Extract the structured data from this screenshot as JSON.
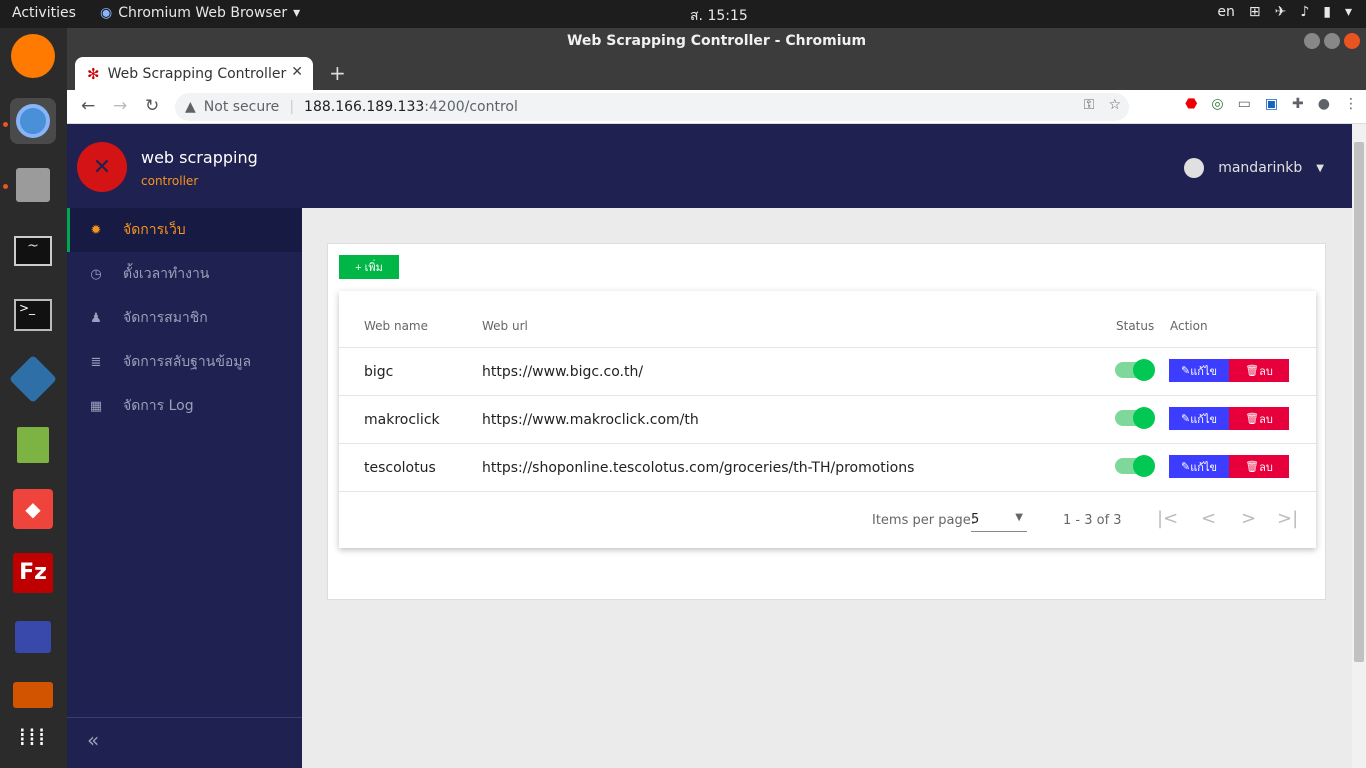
{
  "os": {
    "activities": "Activities",
    "app_menu": "Chromium Web Browser",
    "clock": "ส. 15:15",
    "lang": "en"
  },
  "window": {
    "title": "Web Scrapping Controller - Chromium"
  },
  "tab": {
    "title": "Web Scrapping Controller",
    "new_tab": "+"
  },
  "address": {
    "security": "Not secure",
    "host": "188.166.189.133",
    "path": ":4200/control"
  },
  "app": {
    "brand_title": "web scrapping",
    "brand_sub": "controller",
    "username": "mandarinkb",
    "sidebar": [
      {
        "label": "จัดการเว็บ",
        "icon": "gear-icon",
        "active": true
      },
      {
        "label": "ตั้งเวลาทำงาน",
        "icon": "clock-icon",
        "active": false
      },
      {
        "label": "จัดการสมาชิก",
        "icon": "users-icon",
        "active": false
      },
      {
        "label": "จัดการสลับฐานข้อมูล",
        "icon": "database-icon",
        "active": false
      },
      {
        "label": "จัดการ Log",
        "icon": "calendar-icon",
        "active": false
      }
    ],
    "add_button": "+ เพิ่ม",
    "table": {
      "headers": {
        "name": "Web name",
        "url": "Web url",
        "status": "Status",
        "action": "Action"
      },
      "rows": [
        {
          "name": "bigc",
          "url": "https://www.bigc.co.th/",
          "status": true
        },
        {
          "name": "makroclick",
          "url": "https://www.makroclick.com/th",
          "status": true
        },
        {
          "name": "tescolotus",
          "url": "https://shoponline.tescolotus.com/groceries/th-TH/promotions",
          "status": true
        }
      ],
      "edit_label": "แก้ไข",
      "delete_label": "ลบ"
    },
    "paginator": {
      "items_per_page_label": "Items per page:",
      "items_per_page": "5",
      "range": "1 - 3 of 3"
    }
  },
  "colors": {
    "header_bg": "#1f2150",
    "accent_orange": "#f7941d",
    "add_green": "#00b646",
    "edit_blue": "#3d3dff",
    "delete_red": "#e8003c"
  }
}
